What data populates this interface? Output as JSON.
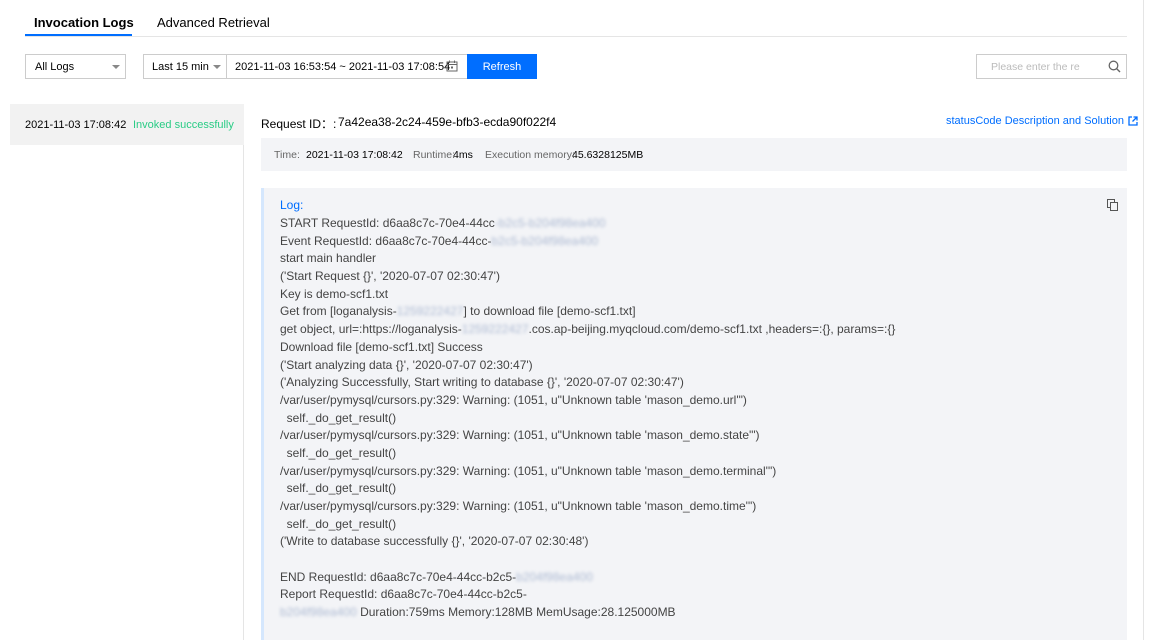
{
  "tabs": {
    "invocation_logs": "Invocation Logs",
    "advanced_retrieval": "Advanced Retrieval"
  },
  "toolbar": {
    "log_filter": "All Logs",
    "time_range_select": "Last 15 minu",
    "date_range": "2021-11-03 16:53:54 ~ 2021-11-03 17:08:54",
    "refresh_label": "Refresh",
    "search_placeholder": "Please enter the re"
  },
  "list": {
    "items": [
      {
        "time": "2021-11-03 17:08:42",
        "status": "Invoked successfully"
      }
    ]
  },
  "detail": {
    "request_id_label": "Request ID：:",
    "request_id": "7a42ea38-2c24-459e-bfb3-ecda90f022f4",
    "status_link": "statusCode Description and Solution",
    "time_label": "Time:",
    "time_value": "2021-11-03 17:08:42",
    "runtime_label": "Runtime:",
    "runtime_value": "4ms",
    "memory_label": "Execution memory:",
    "memory_value": "45.6328125MB"
  },
  "log": {
    "title": "Log:",
    "lines": [
      {
        "text": "START RequestId: d6aa8c7c-70e4-44cc",
        "blur": "-b2c5-b204f98ea400"
      },
      {
        "text": "Event RequestId: d6aa8c7c-70e4-44cc-",
        "blur": "b2c5-b204f98ea400"
      },
      {
        "text": "start main handler"
      },
      {
        "text": "('Start Request {}', '2020-07-07 02:30:47')"
      },
      {
        "text": "Key is demo-scf1.txt"
      },
      {
        "text": "Get from [loganalysis-",
        "blur": "1259222427",
        "after": "] to download file [demo-scf1.txt]"
      },
      {
        "text": "get object, url=:https://loganalysis-",
        "blur": "1259222427",
        "after": ".cos.ap-beijing.myqcloud.com/demo-scf1.txt ,headers=:{}, params=:{}"
      },
      {
        "text": "Download file [demo-scf1.txt] Success"
      },
      {
        "text": "('Start analyzing data {}', '2020-07-07 02:30:47')"
      },
      {
        "text": "('Analyzing Successfully, Start writing to database {}', '2020-07-07 02:30:47')"
      },
      {
        "text": "/var/user/pymysql/cursors.py:329: Warning: (1051, u\"Unknown table 'mason_demo.url'\")"
      },
      {
        "text": "  self._do_get_result()"
      },
      {
        "text": "/var/user/pymysql/cursors.py:329: Warning: (1051, u\"Unknown table 'mason_demo.state'\")"
      },
      {
        "text": "  self._do_get_result()"
      },
      {
        "text": "/var/user/pymysql/cursors.py:329: Warning: (1051, u\"Unknown table 'mason_demo.terminal'\")"
      },
      {
        "text": "  self._do_get_result()"
      },
      {
        "text": "/var/user/pymysql/cursors.py:329: Warning: (1051, u\"Unknown table 'mason_demo.time'\")"
      },
      {
        "text": "  self._do_get_result()"
      },
      {
        "text": "('Write to database successfully {}', '2020-07-07 02:30:48')"
      },
      {
        "text": ""
      },
      {
        "text": "END RequestId: d6aa8c7c-70e4-44cc-b2c5-",
        "blur": "b204f98ea400"
      },
      {
        "text": "Report RequestId: d6aa8c7c-70e4-44cc-b2c5-"
      },
      {
        "text": "",
        "blur": "b204f98ea400",
        "after": " Duration:759ms Memory:128MB MemUsage:28.125000MB"
      }
    ]
  },
  "colors": {
    "accent": "#006eff",
    "success": "#29cc85"
  }
}
